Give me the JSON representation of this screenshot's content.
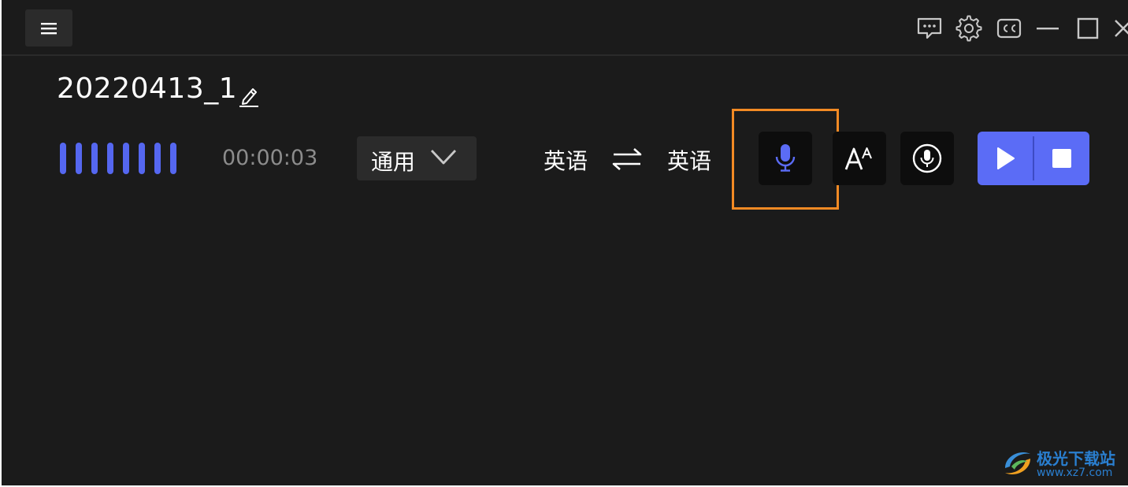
{
  "window": {
    "title_icons": [
      "feedback-icon",
      "settings-icon",
      "captions-icon",
      "minimize-icon",
      "maximize-icon",
      "close-icon"
    ]
  },
  "recording": {
    "name": "20220413_1",
    "elapsed": "00:00:03",
    "wave_bar_count": 8
  },
  "mode_select": {
    "value": "通用"
  },
  "languages": {
    "source": "英语",
    "target": "英语"
  },
  "toolbar": {
    "buttons": [
      "mic-input-button",
      "font-size-button",
      "audio-source-button",
      "play-button",
      "stop-button"
    ]
  },
  "colors": {
    "accent": "#5b6cf6",
    "background": "#1b1b1b",
    "highlight": "#f38a24",
    "muted_text": "#8c8c8c"
  },
  "watermark": {
    "name": "极光下载站",
    "url": "www.xz7.com"
  }
}
